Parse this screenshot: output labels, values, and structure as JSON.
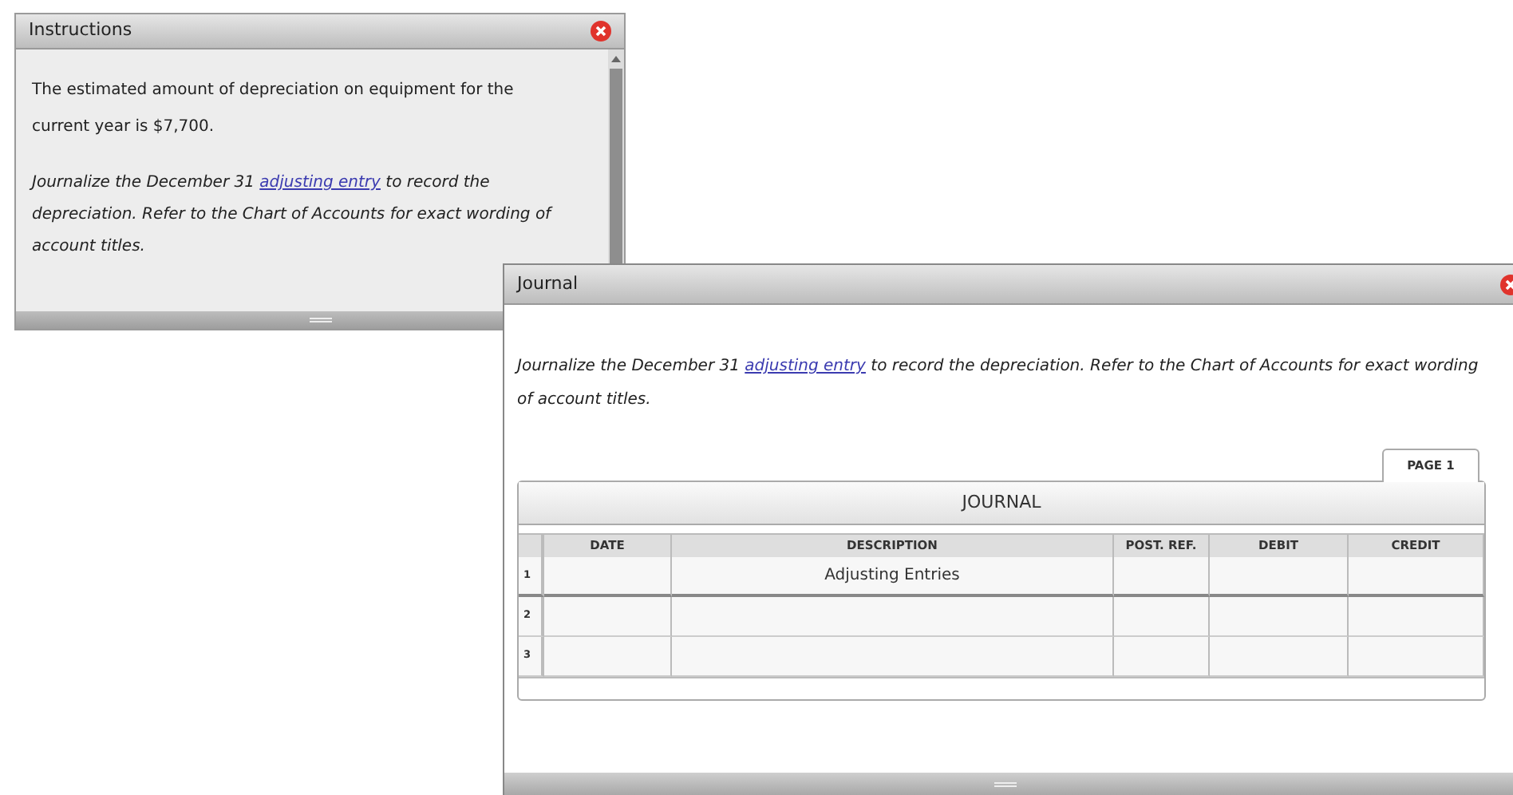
{
  "instructions_window": {
    "title": "Instructions",
    "paragraphs": [
      {
        "kind": "plain",
        "text": "The estimated amount of depreciation on equipment for the current year is $7,700."
      },
      {
        "kind": "italic",
        "before": "Journalize the December 31 ",
        "link": "adjusting entry",
        "after": " to record the depreciation. Refer to the Chart of Accounts for exact wording of account titles."
      }
    ]
  },
  "journal_window": {
    "title": "Journal",
    "prompt": {
      "before": "Journalize the December 31 ",
      "link": "adjusting entry",
      "after": " to record the depreciation. Refer to the Chart of Accounts for exact wording of account titles."
    },
    "tabs": [
      {
        "label": "PAGE 1",
        "selected": true
      }
    ],
    "table": {
      "title": "JOURNAL",
      "columns": [
        "DATE",
        "DESCRIPTION",
        "POST. REF.",
        "DEBIT",
        "CREDIT"
      ],
      "rows": [
        {
          "number": "1",
          "cells": [
            "",
            "Adjusting Entries",
            "",
            "",
            ""
          ]
        },
        {
          "number": "2",
          "cells": [
            "",
            "",
            "",
            "",
            ""
          ]
        },
        {
          "number": "3",
          "cells": [
            "",
            "",
            "",
            "",
            ""
          ]
        }
      ]
    }
  }
}
